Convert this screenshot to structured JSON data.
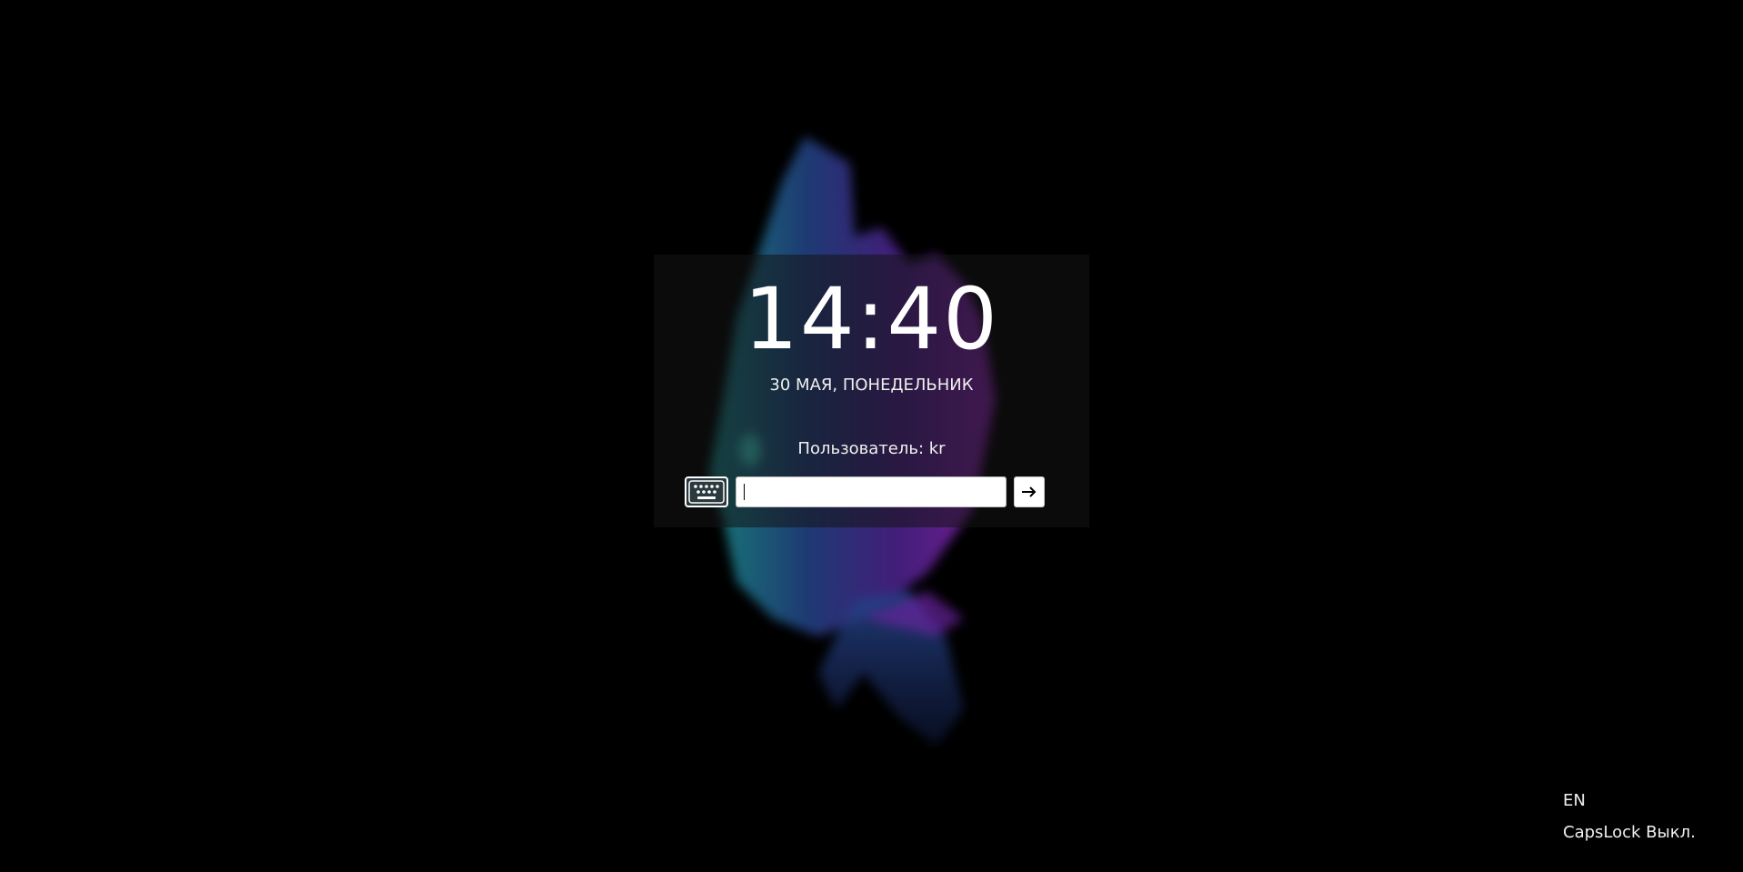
{
  "clock": {
    "time": "14:40"
  },
  "date": {
    "text": "30 МАЯ, ПОНЕДЕЛЬНИК"
  },
  "user": {
    "label": "Пользователь: kr"
  },
  "password": {
    "value": "",
    "placeholder": ""
  },
  "status": {
    "layout": "EN",
    "capslock": "CapsLock Выкл."
  },
  "icons": {
    "keyboard": "keyboard-icon",
    "submit": "arrow-right-icon"
  },
  "colors": {
    "background": "#000000",
    "wallpaper_teal": "#1fa7a5",
    "wallpaper_blue": "#2b4fa0",
    "wallpaper_purple": "#8a2ac0"
  }
}
